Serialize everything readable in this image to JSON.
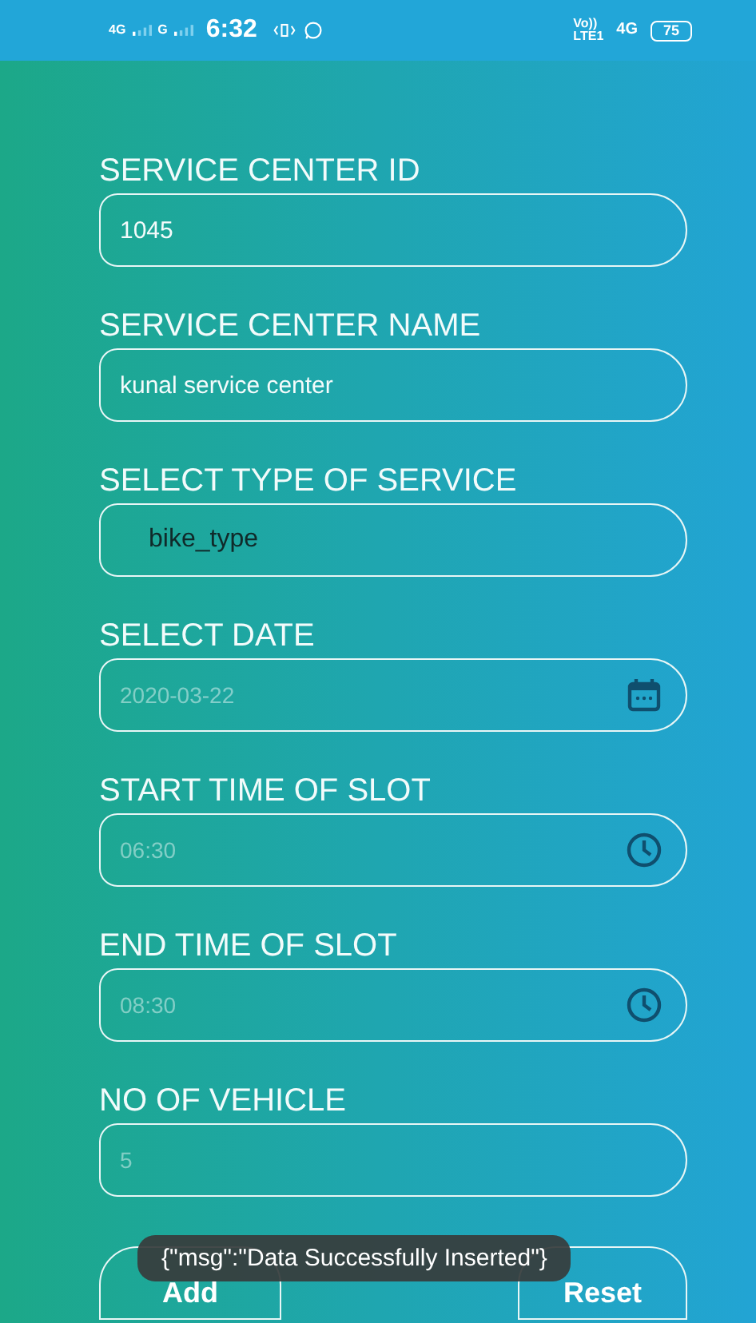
{
  "status_bar": {
    "network_1": "4G",
    "network_2": "G",
    "time": "6:32",
    "volte_top": "Vo))",
    "volte_bottom": "LTE1",
    "network_3": "4G",
    "battery": "75"
  },
  "fields": [
    {
      "label": "SERVICE CENTER ID",
      "kind": "text",
      "value": "1045"
    },
    {
      "label": "SERVICE CENTER NAME",
      "kind": "text",
      "value": "kunal service center"
    },
    {
      "label": "SELECT TYPE OF SERVICE",
      "kind": "select",
      "value": "bike_type"
    },
    {
      "label": "SELECT DATE",
      "kind": "date",
      "placeholder": "2020-03-22"
    },
    {
      "label": "START TIME OF SLOT",
      "kind": "time",
      "placeholder": "06:30"
    },
    {
      "label": "END TIME OF SLOT",
      "kind": "time",
      "placeholder": "08:30"
    },
    {
      "label": "NO OF VEHICLE",
      "kind": "text",
      "placeholder": "5"
    }
  ],
  "buttons": [
    "Add",
    "Reset"
  ],
  "toast": "{\"msg\":\"Data Successfully Inserted\"}"
}
